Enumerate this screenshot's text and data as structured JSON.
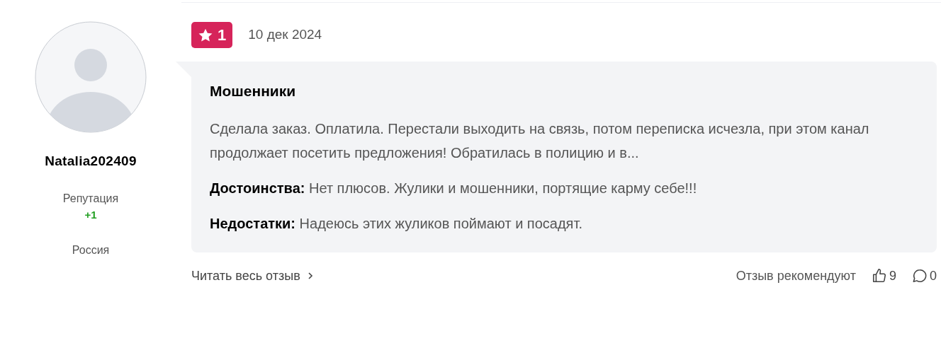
{
  "user": {
    "name": "Natalia202409",
    "reputation_label": "Репутация",
    "reputation_value": "+1",
    "country": "Россия"
  },
  "review": {
    "rating": "1",
    "date": "10 дек 2024",
    "title": "Мошенники",
    "text": "Сделала заказ. Оплатила. Перестали выходить на связь, потом переписка исчезла, при этом канал продолжает посетить предложения! Обратилась в полицию и в...",
    "pros_label": "Достоинства:",
    "pros": "Нет плюсов. Жулики и мошенники, портящие карму себе!!!",
    "cons_label": "Недостатки:",
    "cons": "Надеюсь этих жуликов поймают и посадят."
  },
  "footer": {
    "read_more": "Читать весь отзыв",
    "recommend_label": "Отзыв рекомендуют",
    "likes": "9",
    "comments": "0"
  }
}
